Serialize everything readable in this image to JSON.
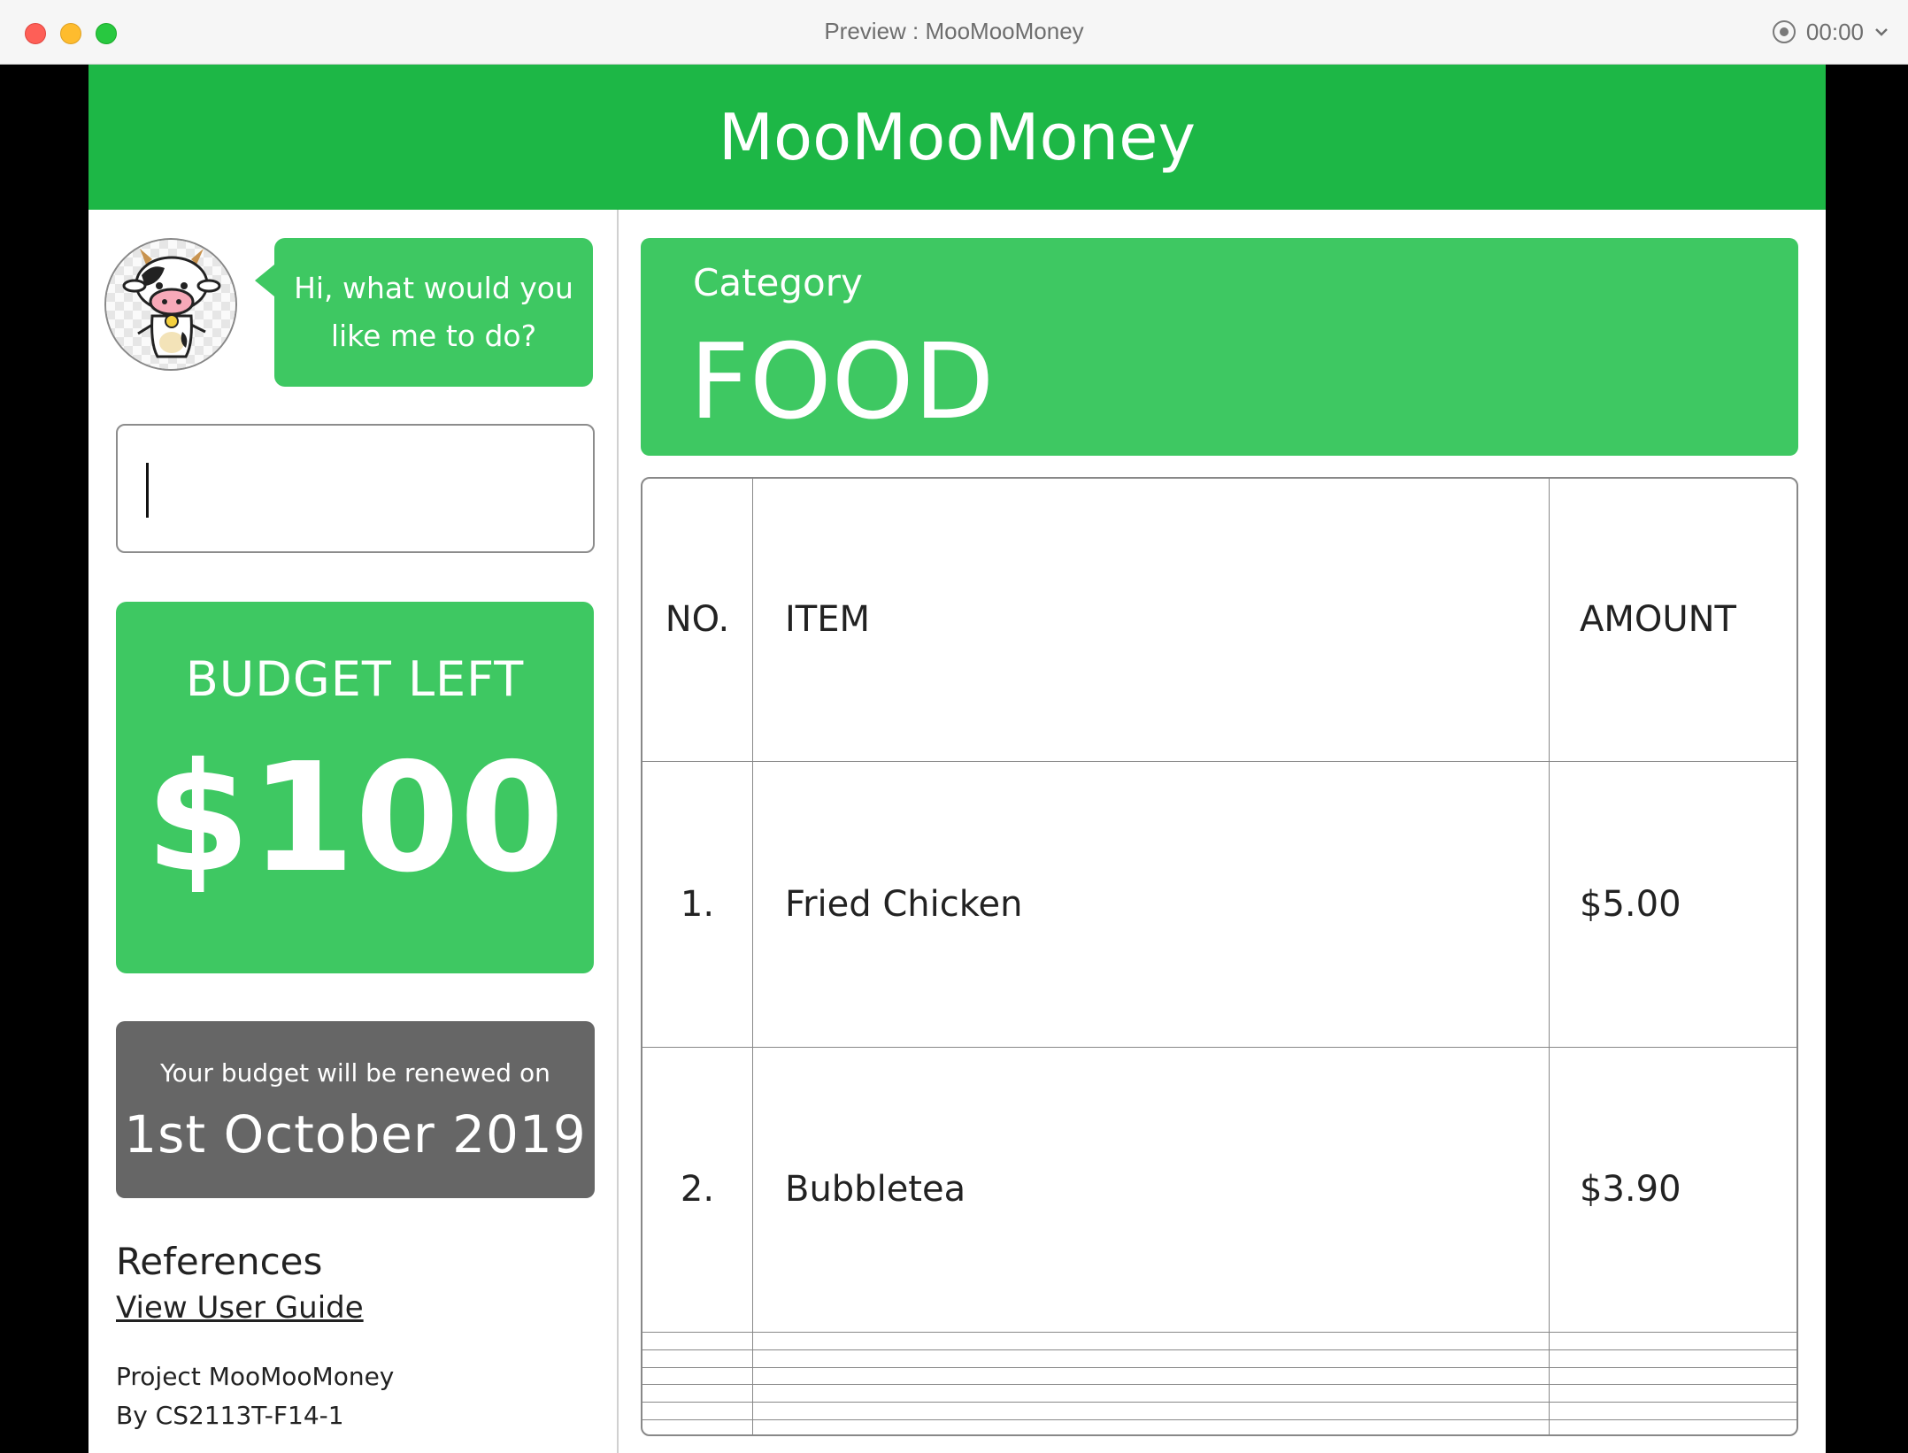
{
  "window": {
    "title": "Preview : MooMooMoney",
    "timer": "00:00",
    "controls": {
      "close_icon": "close-dot",
      "minimize_icon": "minimize-dot",
      "zoom_icon": "zoom-dot",
      "record_icon": "record-icon",
      "chevron_icon": "chevron-down-icon"
    }
  },
  "app": {
    "title": "MooMooMoney",
    "brand_color": "#1db746",
    "accent_color": "#3ec862"
  },
  "assistant": {
    "avatar": "cow-avatar-icon",
    "message_line1": "Hi, what would you",
    "message_line2": "like me to do?"
  },
  "command": {
    "value": ""
  },
  "budget": {
    "label": "BUDGET LEFT",
    "value": "$100"
  },
  "renewal": {
    "note": "Your budget will be renewed on",
    "date": "1st October 2019"
  },
  "references": {
    "title": "References",
    "user_guide_link": "View User Guide"
  },
  "project": {
    "line1": "Project MooMooMoney",
    "line2": "By CS2113T-F14-1"
  },
  "category": {
    "label": "Category",
    "value": "FOOD"
  },
  "table": {
    "columns": [
      "NO.",
      "ITEM",
      "AMOUNT"
    ],
    "rows": [
      {
        "no": "1.",
        "item": "Fried Chicken",
        "amount": "$5.00"
      },
      {
        "no": "2.",
        "item": "Bubbletea",
        "amount": "$3.90"
      },
      {
        "no": "",
        "item": "",
        "amount": ""
      },
      {
        "no": "",
        "item": "",
        "amount": ""
      },
      {
        "no": "",
        "item": "",
        "amount": ""
      },
      {
        "no": "",
        "item": "",
        "amount": ""
      },
      {
        "no": "",
        "item": "",
        "amount": ""
      },
      {
        "no": "",
        "item": "",
        "amount": ""
      }
    ]
  }
}
